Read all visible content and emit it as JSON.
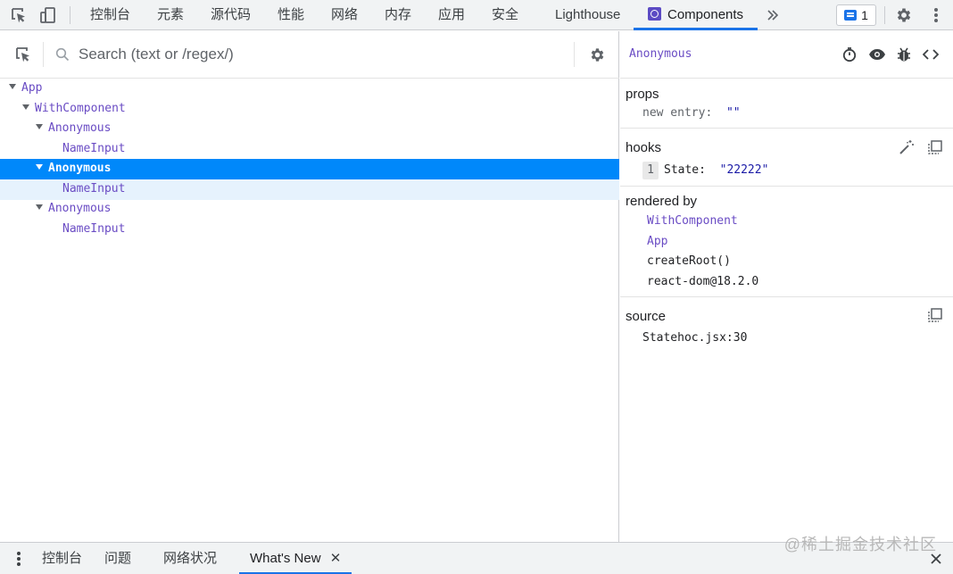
{
  "topbar": {
    "tabs": [
      "控制台",
      "元素",
      "源代码",
      "性能",
      "网络",
      "内存",
      "应用",
      "安全",
      "Lighthouse",
      "Components"
    ],
    "active_tab": "Components",
    "issues_count": "1"
  },
  "search": {
    "placeholder": "Search (text or /regex/)"
  },
  "tree": {
    "nodes": [
      "App",
      "WithComponent",
      "Anonymous",
      "NameInput",
      "Anonymous",
      "NameInput",
      "Anonymous",
      "NameInput"
    ]
  },
  "inspector": {
    "component_name": "Anonymous",
    "props": {
      "title": "props",
      "key": "new entry",
      "value": "\"\""
    },
    "hooks": {
      "title": "hooks",
      "index": "1",
      "key": "State",
      "value": "\"22222\""
    },
    "rendered_by": {
      "title": "rendered by",
      "items": [
        "WithComponent",
        "App",
        "createRoot()",
        "react-dom@18.2.0"
      ]
    },
    "source": {
      "title": "source",
      "file": "Statehoc.jsx:30"
    }
  },
  "drawer": {
    "tabs": [
      "控制台",
      "问题",
      "网络状况",
      "What's New"
    ],
    "active_tab": "What's New"
  },
  "watermark": "@稀土掘金技术社区",
  "colors": {
    "accent": "#1a73e8",
    "selection": "#0088fa",
    "component": "#6a4cc4"
  },
  "icons": [
    "inspect-element-icon",
    "device-toolbar-icon",
    "more-tabs-icon",
    "issues-icon",
    "settings-icon",
    "more-vert-icon",
    "select-component-icon",
    "search-icon",
    "stopwatch-icon",
    "eye-icon",
    "bug-icon",
    "code-icon",
    "magic-wand-icon",
    "copy-icon",
    "drawer-menu-icon",
    "close-icon"
  ]
}
